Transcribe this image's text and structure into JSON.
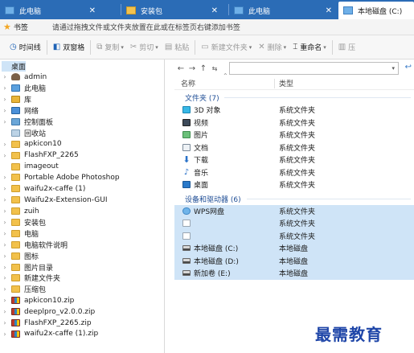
{
  "tabs": [
    {
      "label": "此电脑",
      "icon": "computer-icon",
      "active": false
    },
    {
      "label": "安装包",
      "icon": "folder-icon",
      "active": false
    },
    {
      "label": "此电脑",
      "icon": "computer-icon",
      "active": false
    },
    {
      "label": "本地磁盘 (C:)",
      "icon": "drive-icon",
      "active": true
    }
  ],
  "bookmark_bar": {
    "label": "书签",
    "hint": "请通过拖拽文件或文件夹放置在此或在标签页右键添加书签"
  },
  "toolbar": {
    "timeline": "时间线",
    "dual_pane": "双窗格",
    "copy": "复制",
    "cut": "剪切",
    "paste": "粘贴",
    "new_folder": "新建文件夹",
    "delete": "删除",
    "rename": "重命名",
    "compress": "压"
  },
  "tree": {
    "root": "桌面",
    "items": [
      {
        "label": "admin",
        "icon": "user-icon",
        "expandable": true
      },
      {
        "label": "此电脑",
        "icon": "computer-icon",
        "expandable": true
      },
      {
        "label": "库",
        "icon": "library-icon",
        "expandable": true
      },
      {
        "label": "网络",
        "icon": "network-icon",
        "expandable": true
      },
      {
        "label": "控制面板",
        "icon": "control-panel-icon",
        "expandable": true
      },
      {
        "label": "回收站",
        "icon": "recycle-bin-icon",
        "expandable": false
      },
      {
        "label": "apkicon10",
        "icon": "folder-icon",
        "expandable": true
      },
      {
        "label": "FlashFXP_2265",
        "icon": "folder-icon",
        "expandable": true
      },
      {
        "label": "imageout",
        "icon": "folder-icon",
        "expandable": false
      },
      {
        "label": "Portable Adobe Photoshop",
        "icon": "folder-icon",
        "expandable": true
      },
      {
        "label": "waifu2x-caffe (1)",
        "icon": "folder-icon",
        "expandable": true
      },
      {
        "label": "Waifu2x-Extension-GUI",
        "icon": "folder-icon",
        "expandable": true
      },
      {
        "label": "zuih",
        "icon": "folder-icon",
        "expandable": true
      },
      {
        "label": "安装包",
        "icon": "folder-icon",
        "expandable": true
      },
      {
        "label": "电脑",
        "icon": "folder-icon",
        "expandable": true
      },
      {
        "label": "电脑软件说明",
        "icon": "folder-icon",
        "expandable": true
      },
      {
        "label": "图标",
        "icon": "folder-icon",
        "expandable": true
      },
      {
        "label": "图片目录",
        "icon": "folder-icon",
        "expandable": true
      },
      {
        "label": "新建文件夹",
        "icon": "folder-icon",
        "expandable": true
      },
      {
        "label": "压缩包",
        "icon": "folder-icon",
        "expandable": true
      },
      {
        "label": "apkicon10.zip",
        "icon": "zip-archive-icon",
        "expandable": true
      },
      {
        "label": "deeplpro_v2.0.0.zip",
        "icon": "zip-archive-icon",
        "expandable": true
      },
      {
        "label": "FlashFXP_2265.zip",
        "icon": "zip-archive-icon",
        "expandable": true
      },
      {
        "label": "waifu2x-caffe (1).zip",
        "icon": "zip-archive-icon",
        "expandable": true
      }
    ]
  },
  "columns": {
    "name": "名称",
    "type": "类型"
  },
  "groups": [
    {
      "title": "文件夹 (7)",
      "items": [
        {
          "name": "3D 对象",
          "type": "系统文件夹",
          "icon": "3d-objects-icon",
          "selected": false
        },
        {
          "name": "视频",
          "type": "系统文件夹",
          "icon": "video-icon",
          "selected": false
        },
        {
          "name": "图片",
          "type": "系统文件夹",
          "icon": "pictures-icon",
          "selected": false
        },
        {
          "name": "文档",
          "type": "系统文件夹",
          "icon": "documents-icon",
          "selected": false
        },
        {
          "name": "下载",
          "type": "系统文件夹",
          "icon": "download-icon",
          "selected": false
        },
        {
          "name": "音乐",
          "type": "系统文件夹",
          "icon": "music-icon",
          "selected": false
        },
        {
          "name": "桌面",
          "type": "系统文件夹",
          "icon": "desktop-icon",
          "selected": false
        }
      ]
    },
    {
      "title": "设备和驱动器 (6)",
      "items": [
        {
          "name": "WPS网盘",
          "type": "系统文件夹",
          "icon": "cloud-drive-icon",
          "selected": true
        },
        {
          "name": "",
          "type": "系统文件夹",
          "icon": "blank-file-icon",
          "selected": true
        },
        {
          "name": "",
          "type": "系统文件夹",
          "icon": "blank-file-icon",
          "selected": true
        },
        {
          "name": "本地磁盘 (C:)",
          "type": "本地磁盘",
          "icon": "hard-drive-icon",
          "selected": true
        },
        {
          "name": "本地磁盘 (D:)",
          "type": "本地磁盘",
          "icon": "hard-drive-icon",
          "selected": true
        },
        {
          "name": "新加卷 (E:)",
          "type": "本地磁盘",
          "icon": "hard-drive-icon",
          "selected": true
        }
      ]
    }
  ],
  "watermark": "最需教育",
  "colors": {
    "tab_bar": "#2b6cb6",
    "selection": "#cfe4f7",
    "group_text": "#1f4e96"
  }
}
